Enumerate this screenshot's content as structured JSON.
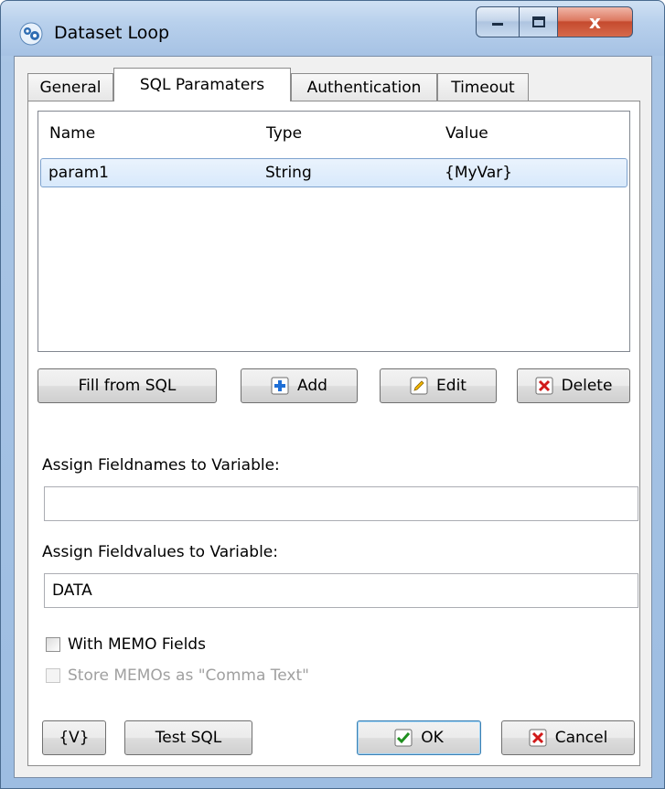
{
  "window": {
    "title": "Dataset Loop",
    "close_glyph": "x"
  },
  "tabs": [
    {
      "label": "General"
    },
    {
      "label": "SQL Paramaters"
    },
    {
      "label": "Authentication"
    },
    {
      "label": "Timeout"
    }
  ],
  "active_tab": "SQL Paramaters",
  "params_table": {
    "columns": [
      "Name",
      "Type",
      "Value"
    ],
    "rows": [
      {
        "name": "param1",
        "type": "String",
        "value": "{MyVar}",
        "selected": true
      }
    ]
  },
  "param_buttons": {
    "fill_from_sql": "Fill from SQL",
    "add": "Add",
    "edit": "Edit",
    "delete": "Delete"
  },
  "fieldnames": {
    "label": "Assign Fieldnames to Variable:",
    "value": ""
  },
  "fieldvalues": {
    "label": "Assign Fieldvalues to Variable:",
    "value": "DATA"
  },
  "checkboxes": {
    "with_memo": {
      "label": "With MEMO Fields",
      "checked": false,
      "enabled": true
    },
    "store_memos": {
      "label": "Store MEMOs as \"Comma Text\"",
      "checked": false,
      "enabled": false
    }
  },
  "footer_buttons": {
    "variable": "{V}",
    "test_sql": "Test SQL",
    "ok": "OK",
    "cancel": "Cancel"
  },
  "icons": {
    "add": "plus-icon",
    "edit": "pencil-icon",
    "delete": "x-icon",
    "ok": "checkmark-icon",
    "cancel": "x-icon"
  },
  "colors": {
    "selection": "#d8e9fb",
    "add_icon": "#1f6fd6",
    "delete_icon": "#d11a1a",
    "ok_icon": "#1f8f1f",
    "title_close": "#c54a2e"
  }
}
